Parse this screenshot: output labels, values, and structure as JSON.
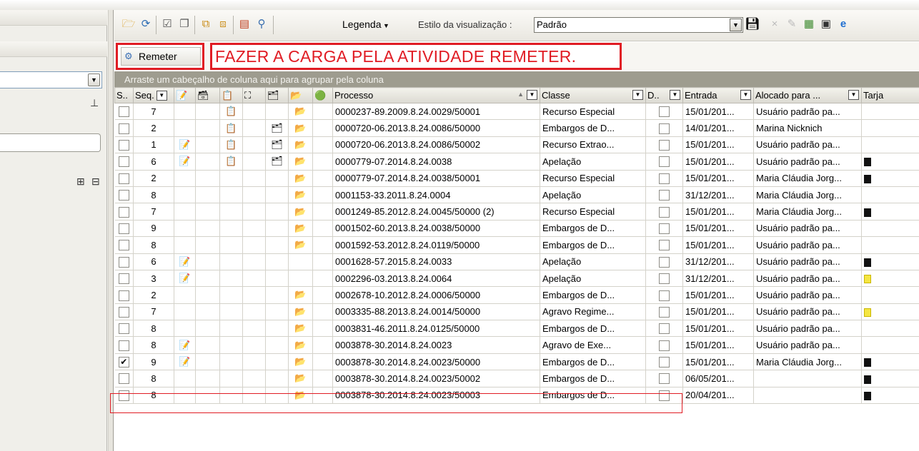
{
  "toolbar": {
    "legenda_label": "Legenda",
    "estilo_label": "Estilo da visualização :",
    "estilo_value": "Padrão"
  },
  "action": {
    "remeter_label": "Remeter",
    "annotation": "FAZER A CARGA PELA ATIVIDADE REMETER."
  },
  "grid": {
    "group_hint": "Arraste um cabeçalho de coluna aqui para agrupar pela coluna",
    "headers": {
      "sel": "S..",
      "seq": "Seq.",
      "processo": "Processo",
      "classe": "Classe",
      "d": "D..",
      "entrada": "Entrada",
      "alocado": "Alocado para ...",
      "tarja": "Tarja"
    },
    "rows": [
      {
        "checked": false,
        "seq": "7",
        "i1": "",
        "i2": "",
        "i3": "📋",
        "i4": "",
        "i5": "",
        "i6": "📂",
        "processo": "0000237-89.2009.8.24.0029/50001",
        "classe": "Recurso Especial",
        "entrada": "15/01/201...",
        "alocado": "Usuário padrão pa...",
        "tarja": ""
      },
      {
        "checked": false,
        "seq": "2",
        "i1": "",
        "i2": "",
        "i3": "📋",
        "i4": "",
        "i5": "🗂",
        "i6": "📂",
        "processo": "0000720-06.2013.8.24.0086/50000",
        "classe": "Embargos de D...",
        "entrada": "14/01/201...",
        "alocado": "Marina Nicknich",
        "tarja": ""
      },
      {
        "checked": false,
        "seq": "1",
        "i1": "📝",
        "i2": "",
        "i3": "📋",
        "i4": "",
        "i5": "🗂",
        "i6": "📂",
        "processo": "0000720-06.2013.8.24.0086/50002",
        "classe": "Recurso Extrao...",
        "entrada": "15/01/201...",
        "alocado": "Usuário padrão pa...",
        "tarja": ""
      },
      {
        "checked": false,
        "seq": "6",
        "i1": "📝",
        "i2": "",
        "i3": "📋",
        "i4": "",
        "i5": "🗂",
        "i6": "📂",
        "processo": "0000779-07.2014.8.24.0038",
        "classe": "Apelação",
        "entrada": "15/01/201...",
        "alocado": "Usuário padrão pa...",
        "tarja": "#111111"
      },
      {
        "checked": false,
        "seq": "2",
        "i1": "",
        "i2": "",
        "i3": "",
        "i4": "",
        "i5": "",
        "i6": "📂",
        "processo": "0000779-07.2014.8.24.0038/50001",
        "classe": "Recurso Especial",
        "entrada": "15/01/201...",
        "alocado": "Maria Cláudia Jorg...",
        "tarja": "#111111"
      },
      {
        "checked": false,
        "seq": "8",
        "i1": "",
        "i2": "",
        "i3": "",
        "i4": "",
        "i5": "",
        "i6": "📂",
        "processo": "0001153-33.2011.8.24.0004",
        "classe": "Apelação",
        "entrada": "31/12/201...",
        "alocado": "Maria Cláudia Jorg...",
        "tarja": ""
      },
      {
        "checked": false,
        "seq": "7",
        "i1": "",
        "i2": "",
        "i3": "",
        "i4": "",
        "i5": "",
        "i6": "📂",
        "processo": "0001249-85.2012.8.24.0045/50000 (2)",
        "classe": "Recurso Especial",
        "entrada": "15/01/201...",
        "alocado": "Maria Cláudia Jorg...",
        "tarja": "#111111"
      },
      {
        "checked": false,
        "seq": "9",
        "i1": "",
        "i2": "",
        "i3": "",
        "i4": "",
        "i5": "",
        "i6": "📂",
        "processo": "0001502-60.2013.8.24.0038/50000",
        "classe": "Embargos de D...",
        "entrada": "15/01/201...",
        "alocado": "Usuário padrão pa...",
        "tarja": ""
      },
      {
        "checked": false,
        "seq": "8",
        "i1": "",
        "i2": "",
        "i3": "",
        "i4": "",
        "i5": "",
        "i6": "📂",
        "processo": "0001592-53.2012.8.24.0119/50000",
        "classe": "Embargos de D...",
        "entrada": "15/01/201...",
        "alocado": "Usuário padrão pa...",
        "tarja": ""
      },
      {
        "checked": false,
        "seq": "6",
        "i1": "📝",
        "i2": "",
        "i3": "",
        "i4": "",
        "i5": "",
        "i6": "",
        "processo": "0001628-57.2015.8.24.0033",
        "classe": "Apelação",
        "entrada": "31/12/201...",
        "alocado": "Usuário padrão pa...",
        "tarja": "#111111"
      },
      {
        "checked": false,
        "seq": "3",
        "i1": "📝",
        "i2": "",
        "i3": "",
        "i4": "",
        "i5": "",
        "i6": "",
        "processo": "0002296-03.2013.8.24.0064",
        "classe": "Apelação",
        "entrada": "31/12/201...",
        "alocado": "Usuário padrão pa...",
        "tarja": "#f5e642"
      },
      {
        "checked": false,
        "seq": "2",
        "i1": "",
        "i2": "",
        "i3": "",
        "i4": "",
        "i5": "",
        "i6": "📂",
        "processo": "0002678-10.2012.8.24.0006/50000",
        "classe": "Embargos de D...",
        "entrada": "15/01/201...",
        "alocado": "Usuário padrão pa...",
        "tarja": ""
      },
      {
        "checked": false,
        "seq": "7",
        "i1": "",
        "i2": "",
        "i3": "",
        "i4": "",
        "i5": "",
        "i6": "📂",
        "processo": "0003335-88.2013.8.24.0014/50000",
        "classe": "Agravo Regime...",
        "entrada": "15/01/201...",
        "alocado": "Usuário padrão pa...",
        "tarja": "#f5e642"
      },
      {
        "checked": false,
        "seq": "8",
        "i1": "",
        "i2": "",
        "i3": "",
        "i4": "",
        "i5": "",
        "i6": "📂",
        "processo": "0003831-46.2011.8.24.0125/50000",
        "classe": "Embargos de D...",
        "entrada": "15/01/201...",
        "alocado": "Usuário padrão pa...",
        "tarja": ""
      },
      {
        "checked": false,
        "seq": "8",
        "i1": "📝",
        "i2": "",
        "i3": "",
        "i4": "",
        "i5": "",
        "i6": "📂",
        "processo": "0003878-30.2014.8.24.0023",
        "classe": "Agravo de Exe...",
        "entrada": "15/01/201...",
        "alocado": "Usuário padrão pa...",
        "tarja": ""
      },
      {
        "checked": true,
        "seq": "9",
        "i1": "📝",
        "i2": "",
        "i3": "",
        "i4": "",
        "i5": "",
        "i6": "📂",
        "processo": "0003878-30.2014.8.24.0023/50000",
        "classe": "Embargos de D...",
        "entrada": "15/01/201...",
        "alocado": "Maria Cláudia Jorg...",
        "tarja": "#111111"
      },
      {
        "checked": false,
        "seq": "8",
        "i1": "",
        "i2": "",
        "i3": "",
        "i4": "",
        "i5": "",
        "i6": "📂",
        "processo": "0003878-30.2014.8.24.0023/50002",
        "classe": "Embargos de D...",
        "entrada": "06/05/201...",
        "alocado": "",
        "tarja": "#111111"
      },
      {
        "checked": false,
        "seq": "8",
        "i1": "",
        "i2": "",
        "i3": "",
        "i4": "",
        "i5": "",
        "i6": "📂",
        "processo": "0003878-30.2014.8.24.0023/50003",
        "classe": "Embargos de D...",
        "entrada": "20/04/201...",
        "alocado": "",
        "tarja": "#111111"
      }
    ]
  }
}
